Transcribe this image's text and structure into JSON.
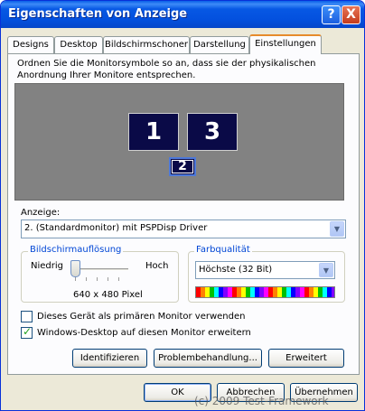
{
  "window": {
    "title": "Eigenschaften von Anzeige",
    "help_label": "?",
    "close_label": "X"
  },
  "tabs": [
    {
      "label": "Designs",
      "active": false
    },
    {
      "label": "Desktop",
      "active": false
    },
    {
      "label": "Bildschirmschoner",
      "active": false
    },
    {
      "label": "Darstellung",
      "active": false
    },
    {
      "label": "Einstellungen",
      "active": true
    }
  ],
  "settings": {
    "intro": "Ordnen Sie die Monitorsymbole so an, dass sie der physikalischen Anordnung Ihrer Monitore entsprechen.",
    "monitors": [
      {
        "number": "1",
        "selected": false
      },
      {
        "number": "3",
        "selected": false
      },
      {
        "number": "2",
        "selected": true
      }
    ],
    "display_label": "Anzeige:",
    "display_value": "2. (Standardmonitor) mit PSPDisp Driver",
    "resolution": {
      "legend": "Bildschirmauflösung",
      "low_label": "Niedrig",
      "high_label": "Hoch",
      "value": "640 x 480 Pixel",
      "slider_level": 0
    },
    "color_quality": {
      "legend": "Farbqualität",
      "value": "Höchste (32 Bit)"
    },
    "primary_checkbox": {
      "label": "Dieses Gerät als primären Monitor verwenden",
      "checked": false
    },
    "extend_checkbox": {
      "label": "Windows-Desktop auf diesen Monitor erweitern",
      "checked": true
    },
    "buttons": {
      "identify": "Identifizieren",
      "troubleshoot": "Problembehandlung...",
      "advanced": "Erweitert"
    }
  },
  "footer": {
    "ok": "OK",
    "cancel": "Abbrechen",
    "apply": "Übernehmen"
  },
  "watermark": "(c) 2009 Test-Framework",
  "colors": {
    "titlebar": "#0558e4",
    "monitor_bg": "#0a0a47",
    "desktop_area": "#828282",
    "group_legend": "#0046d5",
    "active_tab_accent": "#e68b2c"
  }
}
